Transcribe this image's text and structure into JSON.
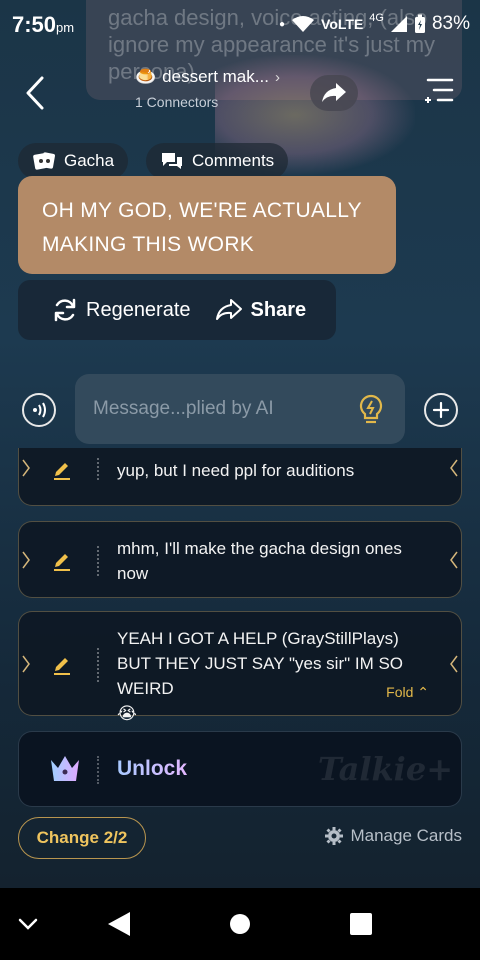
{
  "status_bar": {
    "time": "7:50",
    "ampm": "pm",
    "network": "VoLTE",
    "signal_type": "4G",
    "battery": "83%"
  },
  "background_overlay_text": "gacha design, voice acting, (also ignore my appearance it's just my persona)",
  "header": {
    "title": "dessert mak...",
    "title_emoji": "🍮",
    "subtitle": "1 Connectors"
  },
  "tabs": {
    "gacha_label": "Gacha",
    "comments_label": "Comments"
  },
  "last_message": "OH MY GOD, WE'RE ACTUALLY MAKING THIS WORK",
  "actions": {
    "regenerate_label": "Regenerate",
    "share_label": "Share"
  },
  "input": {
    "placeholder": "Message...plied by AI"
  },
  "reply_cards": [
    {
      "text": "yup, but I need ppl for auditions"
    },
    {
      "text": "mhm, I'll make the gacha design ones now"
    },
    {
      "text": "YEAH I GOT A HELP (GrayStillPlays) BUT THEY JUST SAY \"yes sir\" IM SO WEIRD",
      "emoji": "😭",
      "fold_label": "Fold"
    }
  ],
  "unlock": {
    "label": "Unlock",
    "brand": "Talkie"
  },
  "footer": {
    "change_label": "Change 2/2",
    "manage_label": "Manage Cards"
  },
  "colors": {
    "accent_gold": "#efc45e",
    "bubble": "#b38a67",
    "input_bg": "#334a5c"
  }
}
